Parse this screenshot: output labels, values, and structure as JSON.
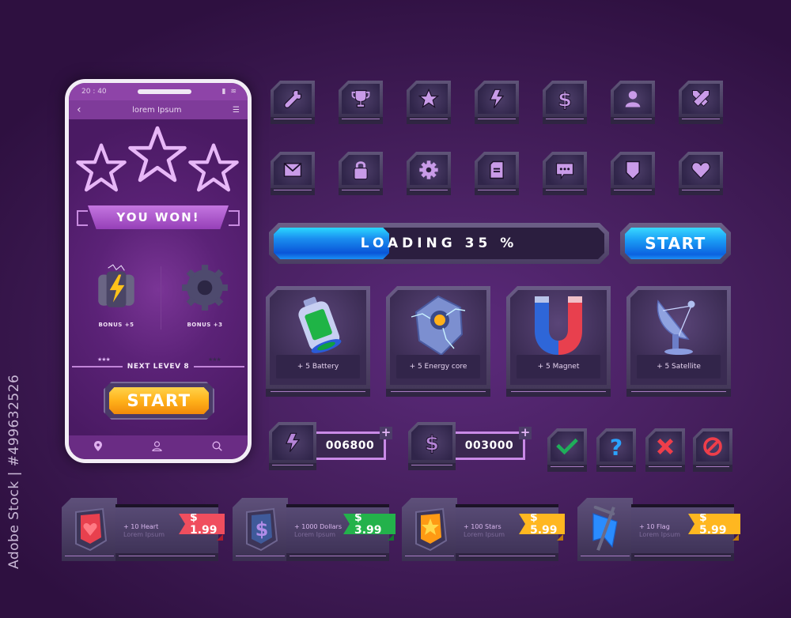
{
  "watermark": {
    "side_text": "Adobe Stock | #499632526"
  },
  "phone": {
    "status_time": "20 : 40",
    "nav_title": "lorem Ipsum",
    "nav_back_icon": "chevron-left-icon",
    "nav_menu_icon": "menu-icon",
    "stars_earned": 3,
    "result_banner": "YOU WON!",
    "bonuses": [
      {
        "icon": "battery-pack-icon",
        "label": "BONUS +5"
      },
      {
        "icon": "gear-icon",
        "label": "BONUS +3"
      }
    ],
    "next_level_label": "NEXT LEVEV  8",
    "mini_stars_left": "★★★",
    "mini_stars_right": "★★★",
    "start_label": "START",
    "tabs": [
      {
        "icon": "location-pin-icon",
        "glyph": "⬤"
      },
      {
        "icon": "user-icon",
        "glyph": "⚲"
      },
      {
        "icon": "search-icon",
        "glyph": "⌕"
      }
    ]
  },
  "icon_tiles": {
    "row1": [
      "wrench-icon",
      "trophy-icon",
      "star-icon",
      "lightning-icon",
      "dollar-icon",
      "user-icon",
      "crossed-swords-icon"
    ],
    "row2": [
      "mail-icon",
      "lock-icon",
      "settings-gear-icon",
      "document-icon",
      "chat-icon",
      "shield-icon",
      "heart-icon"
    ]
  },
  "loading": {
    "label": "LOADING 35 %",
    "progress_percent": 35
  },
  "start_button": {
    "label": "START"
  },
  "cards": [
    {
      "icon": "battery-icon",
      "caption": "+ 5 Battery"
    },
    {
      "icon": "energy-core-icon",
      "caption": "+ 5 Energy core"
    },
    {
      "icon": "magnet-icon",
      "caption": "+ 5  Magnet"
    },
    {
      "icon": "satellite-icon",
      "caption": "+ 5  Satellite"
    }
  ],
  "counters": [
    {
      "icon": "lightning-icon",
      "value": "006800",
      "plus": "+"
    },
    {
      "icon": "dollar-icon",
      "value": "003000",
      "plus": "+"
    }
  ],
  "status_buttons": [
    "check-icon",
    "question-icon",
    "close-icon",
    "forbidden-icon"
  ],
  "store": [
    {
      "icon": "heart-gem-icon",
      "title": "+ 10 Heart",
      "sub": "Lorem Ipsum",
      "price": "$ 1.99",
      "color": "#f04e5e",
      "fold": "#b01c2c"
    },
    {
      "icon": "dollar-gem-icon",
      "title": "+ 1000 Dollars",
      "sub": "Lorem Ipsum",
      "price": "$ 3.99",
      "color": "#23b24b",
      "fold": "#137a30"
    },
    {
      "icon": "star-gem-icon",
      "title": "+ 100 Stars",
      "sub": "Lorem Ipsum",
      "price": "$ 5.99",
      "color": "#ffb720",
      "fold": "#c07a0a"
    },
    {
      "icon": "flag-icon",
      "title": "+ 10  Flag",
      "sub": "Lorem Ipsum",
      "price": "$ 5.99",
      "color": "#ffb720",
      "fold": "#c07a0a"
    }
  ],
  "colors": {
    "background": "#47205f",
    "icon_glyph": "#c99be8",
    "loading_fill": "#1a8ef0",
    "start_orange": "#ffb21a",
    "counter_border": "#c98ae6"
  }
}
